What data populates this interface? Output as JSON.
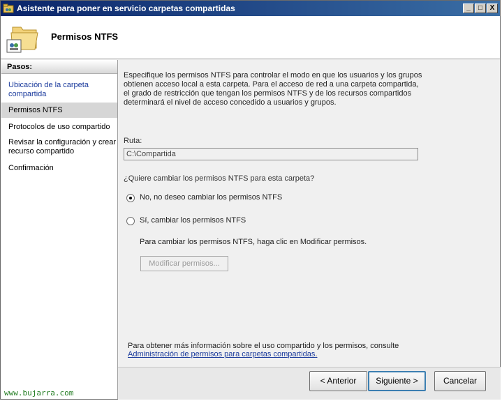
{
  "window": {
    "title": "Asistente para poner en servicio carpetas compartidas",
    "controls": [
      "_",
      "□",
      "X"
    ]
  },
  "header": {
    "page_title": "Permisos NTFS",
    "icon": "folder-share-icon"
  },
  "nav": {
    "heading": "Pasos:",
    "items": [
      {
        "label": "Ubicación de la carpeta compartida",
        "state": "link"
      },
      {
        "label": "Permisos NTFS",
        "state": "selected"
      },
      {
        "label": "Protocolos de uso compartido",
        "state": "normal"
      },
      {
        "label": "Revisar la configuración y crear recurso compartido",
        "state": "normal"
      },
      {
        "label": "Confirmación",
        "state": "normal"
      }
    ],
    "watermark": "www.bujarra.com"
  },
  "content": {
    "description": "Especifique los permisos NTFS para controlar el modo en que los usuarios y los grupos obtienen acceso local a esta carpeta. Para el acceso de red a una carpeta compartida, el grado de restricción que tengan los permisos NTFS y de los recursos compartidos determinará el nivel de acceso concedido a usuarios y grupos.",
    "path_label": "Ruta:",
    "path_value": "C:\\Compartida",
    "question": "¿Quiere cambiar los permisos NTFS para esta carpeta?",
    "option_no": "No, no deseo cambiar los permisos NTFS",
    "option_yes": "Sí, cambiar los permisos NTFS",
    "selected_option": "no",
    "hint": "Para cambiar los permisos NTFS, haga clic en Modificar permisos.",
    "modify_button": "Modificar permisos...",
    "more_info": "Para obtener más información sobre el uso compartido y los permisos, consulte",
    "more_link": "Administración de permisos para carpetas compartidas",
    "more_link_suffix": "."
  },
  "footer": {
    "back": "< Anterior",
    "next": "Siguiente >",
    "cancel": "Cancelar"
  },
  "colors": {
    "titlebar": "#0a246a",
    "link": "#1a3a9c",
    "watermark": "#1e7a1e"
  }
}
